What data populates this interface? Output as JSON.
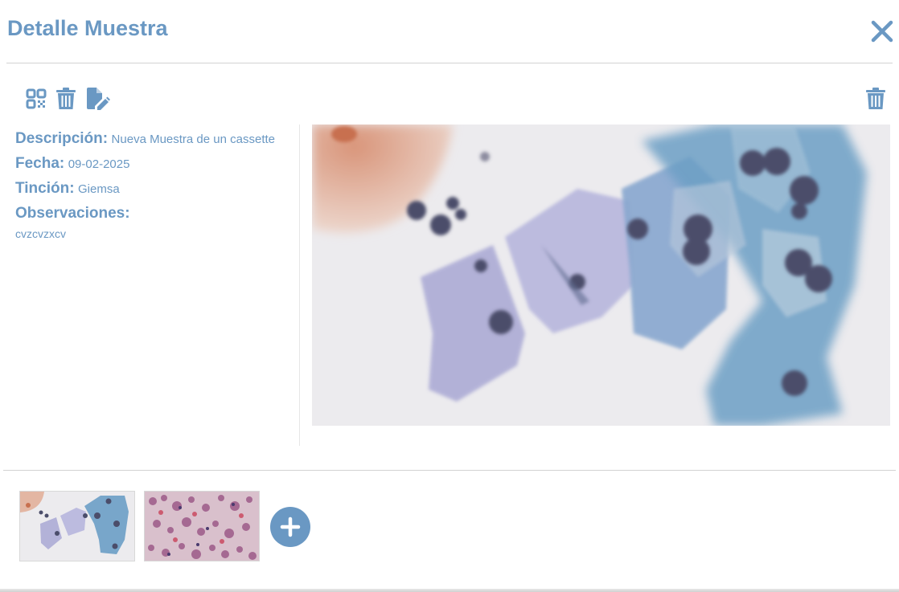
{
  "modal": {
    "title": "Detalle Muestra",
    "close_icon": "close-icon"
  },
  "toolbar": {
    "left_icons": [
      "qr-code-icon",
      "trash-icon",
      "edit-document-icon"
    ],
    "right_icon": "trash-icon"
  },
  "details": {
    "descripcion_label": "Descripción:",
    "descripcion_value": "Nueva Muestra de un cassette",
    "fecha_label": "Fecha:",
    "fecha_value": "09-02-2025",
    "tincion_label": "Tinción:",
    "tincion_value": "Giemsa",
    "observaciones_label": "Observaciones:",
    "observaciones_value": "cvzcvzxcv"
  },
  "gallery": {
    "thumbnail_count": 2,
    "add_icon": "plus-icon"
  },
  "colors": {
    "accent": "#6a98c3",
    "divider": "#d2d2d2"
  }
}
